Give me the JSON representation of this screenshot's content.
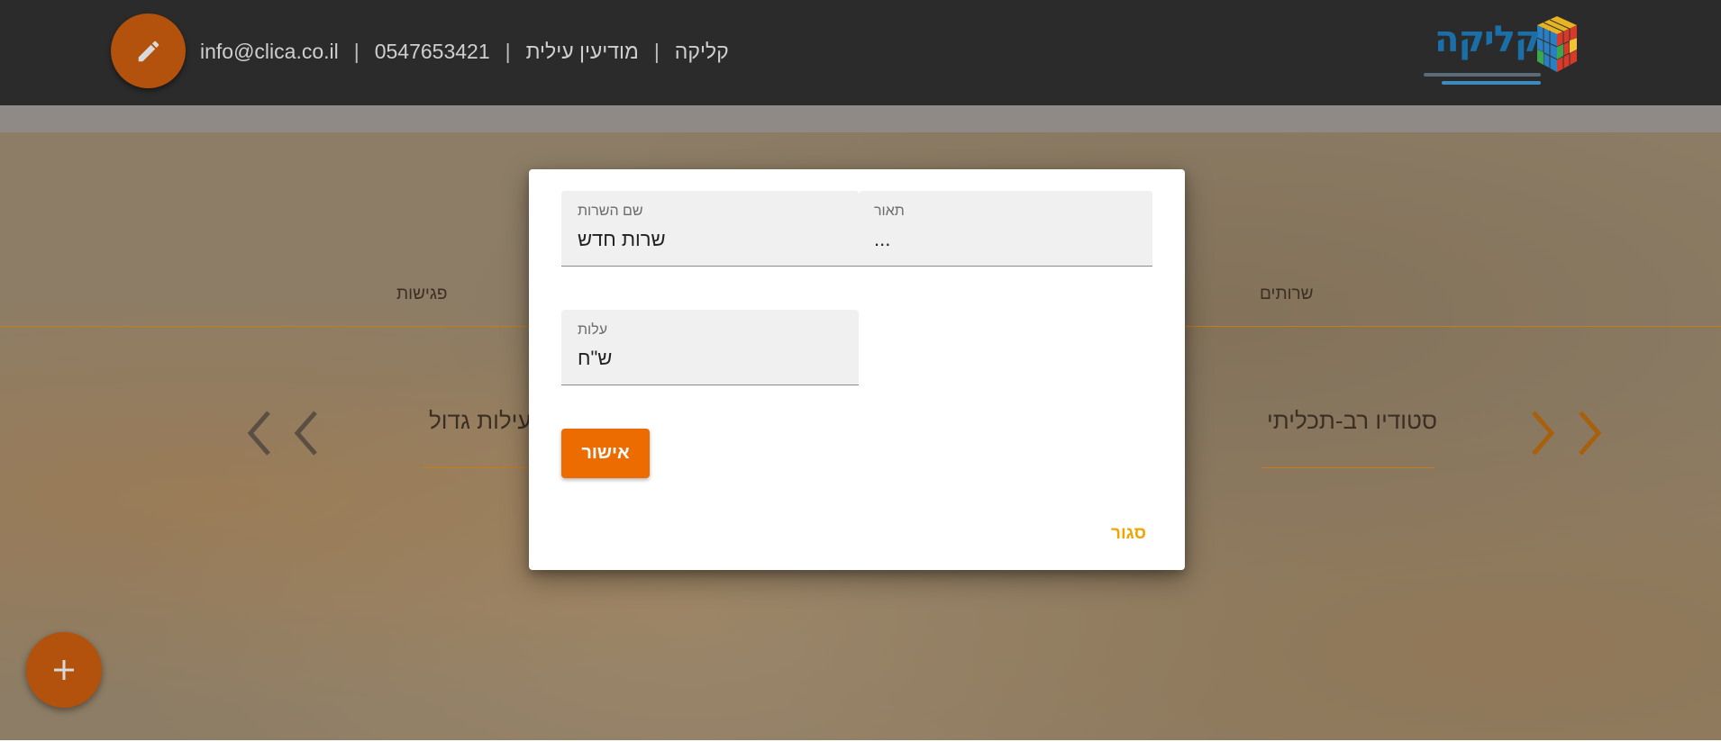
{
  "header": {
    "email": "info@clica.co.il",
    "phone": "0547653421",
    "city": "מודיעין עילית",
    "brand": "קליקה",
    "separator": "|",
    "logo_text": "קליקה",
    "edit_icon": "pencil-icon"
  },
  "background": {
    "tab_meetings": "פגישות",
    "tab_services": "שרותים",
    "card_right_title": "סטודיו רב-תכליתי",
    "card_left_title": "פעילות גדול",
    "prev_icon": "chevron-left-icon",
    "next_icon": "chevron-right-icon",
    "add_icon": "plus-icon"
  },
  "dialog": {
    "service_name_label": "שם השרות",
    "service_name_value": "שרות חדש",
    "description_label": "תאור",
    "description_value": "...",
    "cost_label": "עלות",
    "cost_value": "ש\"ח",
    "confirm_label": "אישור",
    "close_label": "סגור"
  },
  "colors": {
    "header_bg": "#2b2b2b",
    "fab": "#b2520d",
    "confirm": "#ed6c02",
    "close_link": "#f0a500",
    "accent_line": "#c97a1a"
  }
}
